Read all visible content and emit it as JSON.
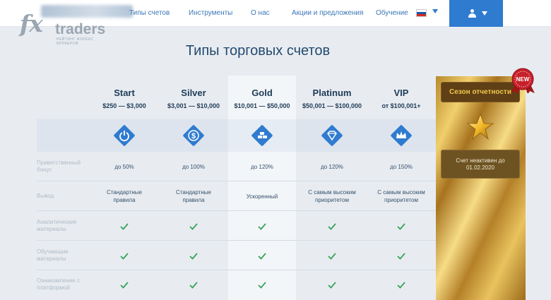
{
  "header": {
    "logo_text_fx": "fx",
    "logo_text_traders": "traders",
    "logo_subtitle": "РЕЙТИНГ ФОРЕКС БРОКЕРОВ",
    "nav": [
      "Типы счетов",
      "Инструменты",
      "О нас",
      "Акции и предложения",
      "Обучение"
    ],
    "language": "Русский"
  },
  "page_title": "Типы торговых счетов",
  "accounts": [
    {
      "name": "Start",
      "range": "$250 — $3,000",
      "icon": "power-icon",
      "bonus": "до 50%",
      "withdrawal": "Стандартные правила",
      "analytics": true,
      "education": true,
      "platform": true
    },
    {
      "name": "Silver",
      "range": "$3,001 — $10,000",
      "icon": "dollar-icon",
      "bonus": "до 100%",
      "withdrawal": "Стандартные правила",
      "analytics": true,
      "education": true,
      "platform": true
    },
    {
      "name": "Gold",
      "range": "$10,001 — $50,000",
      "icon": "gold-bars-icon",
      "bonus": "до 120%",
      "withdrawal": "Ускоренный",
      "analytics": true,
      "education": true,
      "platform": true
    },
    {
      "name": "Platinum",
      "range": "$50,001 — $100,000",
      "icon": "diamond-icon",
      "bonus": "до 120%",
      "withdrawal": "С самым высоким приоритетом",
      "analytics": true,
      "education": true,
      "platform": true
    },
    {
      "name": "VIP",
      "range": "от $100,001+",
      "icon": "crown-icon",
      "bonus": "до 150%",
      "withdrawal": "С самым высоким приоритетом",
      "analytics": true,
      "education": true,
      "platform": true
    }
  ],
  "row_labels": {
    "bonus": "Приветственный бонус",
    "withdrawal": "Вывод",
    "analytics": "Аналитические материалы",
    "education": "Обучающие материалы",
    "platform": "Ознакомление с платформой"
  },
  "season": {
    "title": "Сезон отчетности",
    "badge": "NEW",
    "status": "Счет неактивен до",
    "date": "01.02.2020"
  },
  "colors": {
    "accent": "#2f7bd0",
    "check": "#3aa35a",
    "heading": "#1f3b57"
  }
}
